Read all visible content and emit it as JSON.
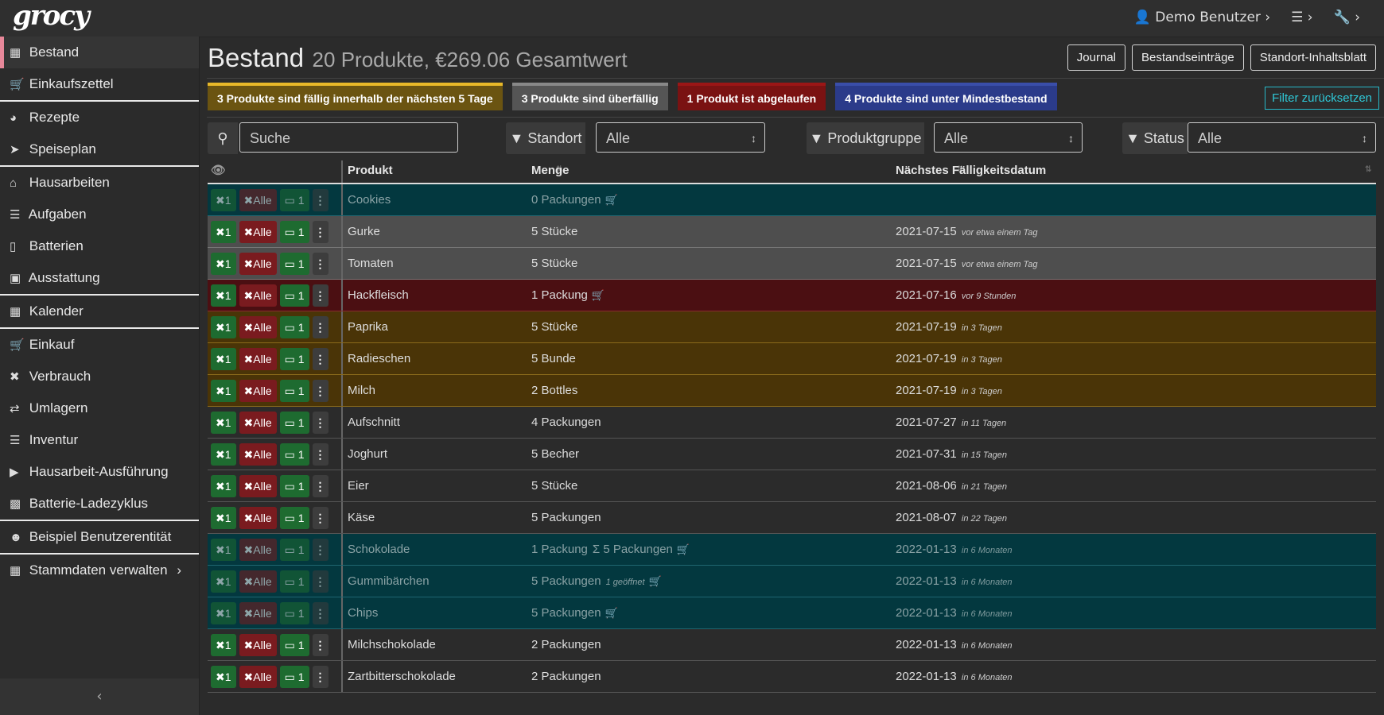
{
  "app": {
    "logo": "grocy"
  },
  "topbar": {
    "user": "Demo Benutzer",
    "settings_icon": "sliders-icon",
    "tools_icon": "wrench-icon"
  },
  "sidebar": {
    "items": [
      {
        "label": "Bestand",
        "icon": "boxes-icon"
      },
      {
        "label": "Einkaufszettel",
        "icon": "cart-icon"
      },
      {
        "label": "Rezepte",
        "icon": "pizza-icon"
      },
      {
        "label": "Speiseplan",
        "icon": "paper-plane-icon"
      },
      {
        "label": "Hausarbeiten",
        "icon": "home-icon"
      },
      {
        "label": "Aufgaben",
        "icon": "tasks-icon"
      },
      {
        "label": "Batterien",
        "icon": "battery-icon"
      },
      {
        "label": "Ausstattung",
        "icon": "toolbox-icon"
      },
      {
        "label": "Kalender",
        "icon": "calendar-icon"
      },
      {
        "label": "Einkauf",
        "icon": "cart-plus-icon"
      },
      {
        "label": "Verbrauch",
        "icon": "utensils-icon"
      },
      {
        "label": "Umlagern",
        "icon": "exchange-icon"
      },
      {
        "label": "Inventur",
        "icon": "list-icon"
      },
      {
        "label": "Hausarbeit-Ausführung",
        "icon": "play-icon"
      },
      {
        "label": "Batterie-Ladezyklus",
        "icon": "car-battery-icon"
      },
      {
        "label": "Beispiel Benutzerentität",
        "icon": "smile-icon"
      },
      {
        "label": "Stammdaten verwalten",
        "icon": "table-icon"
      }
    ]
  },
  "header": {
    "title": "Bestand",
    "subtitle": "20 Produkte, €269.06 Gesamtwert",
    "buttons": [
      "Journal",
      "Bestandseinträge",
      "Standort-Inhaltsblatt"
    ]
  },
  "badges": {
    "due_soon": "3 Produkte sind fällig innerhalb der nächsten 5 Tage",
    "overdue": "3 Produkte sind überfällig",
    "expired": "1 Produkt ist abgelaufen",
    "below_min": "4 Produkte sind unter Mindestbestand"
  },
  "filter_reset": "Filter zurücksetzen",
  "filters": {
    "search_placeholder": "Suche",
    "location_label": "Standort",
    "location_value": "Alle",
    "group_label": "Produktgruppe",
    "group_value": "Alle",
    "status_label": "Status",
    "status_value": "Alle"
  },
  "table": {
    "headers": {
      "product": "Produkt",
      "amount": "Menge",
      "due": "Nächstes Fälligkeitsdatum"
    },
    "action_labels": {
      "consume_one": "1",
      "consume_all": "Alle",
      "open_one": "1"
    },
    "rows": [
      {
        "product": "Cookies",
        "amount": "0 Packungen",
        "extra": "",
        "cart": true,
        "date": "",
        "rel": "",
        "style": "teal"
      },
      {
        "product": "Gurke",
        "amount": "5 Stücke",
        "extra": "",
        "cart": false,
        "date": "2021-07-15",
        "rel": "vor etwa einem Tag",
        "style": "grey"
      },
      {
        "product": "Tomaten",
        "amount": "5 Stücke",
        "extra": "",
        "cart": false,
        "date": "2021-07-15",
        "rel": "vor etwa einem Tag",
        "style": "grey"
      },
      {
        "product": "Hackfleisch",
        "amount": "1 Packung",
        "extra": "",
        "cart": true,
        "date": "2021-07-16",
        "rel": "vor 9 Stunden",
        "style": "red"
      },
      {
        "product": "Paprika",
        "amount": "5 Stücke",
        "extra": "",
        "cart": false,
        "date": "2021-07-19",
        "rel": "in 3 Tagen",
        "style": "amber"
      },
      {
        "product": "Radieschen",
        "amount": "5 Bunde",
        "extra": "",
        "cart": false,
        "date": "2021-07-19",
        "rel": "in 3 Tagen",
        "style": "amber"
      },
      {
        "product": "Milch",
        "amount": "2 Bottles",
        "extra": "",
        "cart": false,
        "date": "2021-07-19",
        "rel": "in 3 Tagen",
        "style": "amber"
      },
      {
        "product": "Aufschnitt",
        "amount": "4 Packungen",
        "extra": "",
        "cart": false,
        "date": "2021-07-27",
        "rel": "in 11 Tagen",
        "style": "plain"
      },
      {
        "product": "Joghurt",
        "amount": "5 Becher",
        "extra": "",
        "cart": false,
        "date": "2021-07-31",
        "rel": "in 15 Tagen",
        "style": "plain"
      },
      {
        "product": "Eier",
        "amount": "5 Stücke",
        "extra": "",
        "cart": false,
        "date": "2021-08-06",
        "rel": "in 21 Tagen",
        "style": "plain"
      },
      {
        "product": "Käse",
        "amount": "5 Packungen",
        "extra": "",
        "cart": false,
        "date": "2021-08-07",
        "rel": "in 22 Tagen",
        "style": "plain"
      },
      {
        "product": "Schokolade",
        "amount": "1 Packung",
        "extra": "Σ 5 Packungen",
        "cart": true,
        "date": "2022-01-13",
        "rel": "in 6 Monaten",
        "style": "teal"
      },
      {
        "product": "Gummibärchen",
        "amount": "5 Packungen",
        "extra": "1 geöffnet",
        "cart": true,
        "date": "2022-01-13",
        "rel": "in 6 Monaten",
        "style": "teal"
      },
      {
        "product": "Chips",
        "amount": "5 Packungen",
        "extra": "",
        "cart": true,
        "date": "2022-01-13",
        "rel": "in 6 Monaten",
        "style": "teal"
      },
      {
        "product": "Milchschokolade",
        "amount": "2 Packungen",
        "extra": "",
        "cart": false,
        "date": "2022-01-13",
        "rel": "in 6 Monaten",
        "style": "plain"
      },
      {
        "product": "Zartbitterschokolade",
        "amount": "2 Packungen",
        "extra": "",
        "cart": false,
        "date": "2022-01-13",
        "rel": "in 6 Monaten",
        "style": "plain"
      }
    ]
  },
  "colors": {
    "accent_active": "#e8889a",
    "teal_row": "#03383f",
    "grey_row": "#4e4e4e",
    "red_row": "#4b0f12",
    "amber_row": "#4a3407",
    "button_green": "#1e6b30",
    "button_red": "#7a1b1f",
    "filter_reset": "#2fc7d6"
  }
}
